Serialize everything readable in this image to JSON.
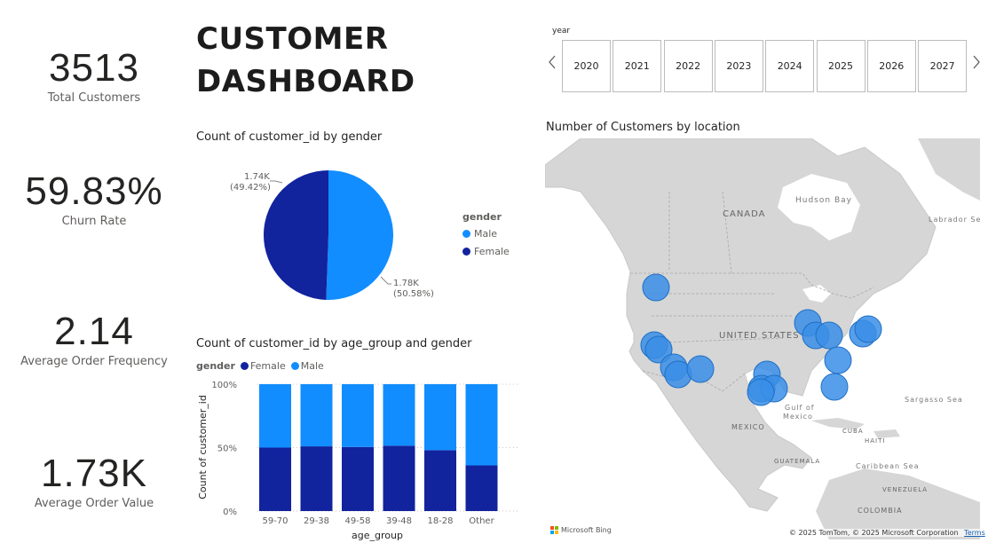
{
  "kpis": [
    {
      "value": "3513",
      "label": "Total Customers"
    },
    {
      "value": "59.83%",
      "label": "Churn Rate"
    },
    {
      "value": "2.14",
      "label": "Average Order Frequency"
    },
    {
      "value": "1.73K",
      "label": "Average Order Value"
    }
  ],
  "title_line1": "CUSTOMER",
  "title_line2": "DASHBOARD",
  "year_slicer": {
    "label": "year",
    "years": [
      "2020",
      "2021",
      "2022",
      "2023",
      "2024",
      "2025",
      "2026",
      "2027"
    ],
    "prev_icon": "chevron-left-icon",
    "next_icon": "chevron-right-icon"
  },
  "colors": {
    "male": "#118dff",
    "female": "#12239e",
    "map_water": "#ffffff",
    "map_land": "#d6d6d6",
    "bubble": "#3a8ee6"
  },
  "chart_data": [
    {
      "type": "pie",
      "title": "Count of customer_id by gender",
      "legend_title": "gender",
      "legend_position": "right",
      "slices": [
        {
          "name": "Male",
          "value": 1.78,
          "label": "1.78K",
          "pct_label": "(50.58%)"
        },
        {
          "name": "Female",
          "value": 1.74,
          "label": "1.74K",
          "pct_label": "(49.42%)"
        }
      ]
    },
    {
      "type": "bar",
      "stacked": "100%",
      "title": "Count of customer_id by age_group and gender",
      "legend_title": "gender",
      "legend_position": "top-left",
      "xlabel": "age_group",
      "ylabel": "Count of customer_id",
      "categories": [
        "59-70",
        "29-38",
        "49-58",
        "39-48",
        "18-28",
        "Other"
      ],
      "yticks": [
        "100%",
        "50%",
        "0%"
      ],
      "ylim": [
        0,
        100
      ],
      "series": [
        {
          "name": "Female",
          "values": [
            50,
            51,
            50.5,
            51.5,
            48,
            36
          ]
        },
        {
          "name": "Male",
          "values": [
            50,
            49,
            49.5,
            48.5,
            52,
            64
          ]
        }
      ]
    }
  ],
  "map": {
    "title": "Number of Customers by location",
    "labels": {
      "hudson_bay": "Hudson Bay",
      "canada": "CANADA",
      "labrador_sea": "Labrador Sea",
      "united_states": "UNITED STATES",
      "gulf_line1": "Gulf of",
      "gulf_line2": "Mexico",
      "mexico": "MEXICO",
      "cuba": "CUBA",
      "haiti": "HAITI",
      "guatemala": "GUATEMALA",
      "caribbean_sea": "Caribbean Sea",
      "sargasso_sea": "Sargasso Sea",
      "venezuela": "VENEZUELA",
      "colombia": "COLOMBIA"
    },
    "bing_logo": "Microsoft Bing",
    "attribution": "© 2025 TomTom, © 2025 Microsoft Corporation",
    "terms": "Terms"
  }
}
